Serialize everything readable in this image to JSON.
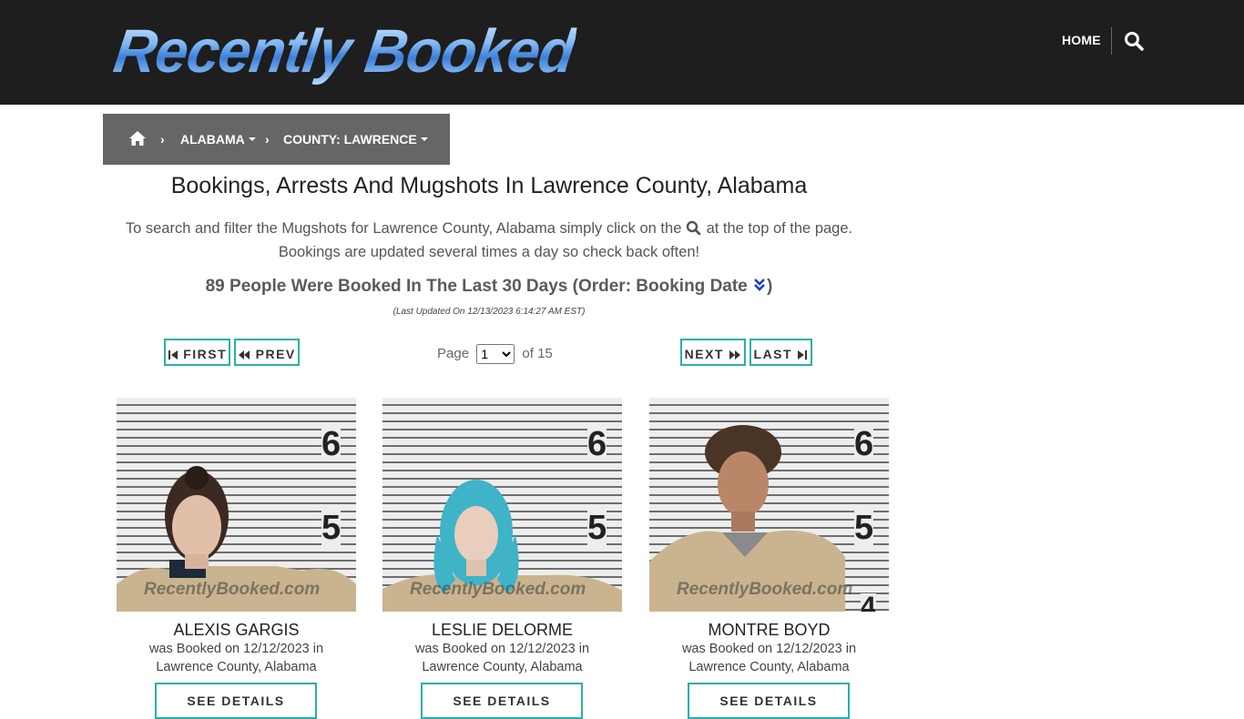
{
  "header": {
    "logo_text": "Recently Booked",
    "nav_home": "HOME"
  },
  "breadcrumb": {
    "state": "ALABAMA",
    "county": "COUNTY: LAWRENCE"
  },
  "page": {
    "title": "Bookings, Arrests And Mugshots In Lawrence County, Alabama",
    "intro_part1": "To search and filter the Mugshots for Lawrence County, Alabama simply click on the",
    "intro_part2": "at the top of the page.",
    "intro_line2": "Bookings are updated several times a day so check back often!",
    "count_text": "89 People Were Booked In The Last 30 Days (Order: Booking Date",
    "count_close": ")",
    "updated": "(Last Updated On 12/13/2023 6:14:27 AM EST)"
  },
  "pagination": {
    "first": "FIRST",
    "prev": "PREV",
    "next": "NEXT",
    "last": "LAST",
    "page_label": "Page",
    "current_page": "1",
    "of_label": "of 15"
  },
  "cards": [
    {
      "name": "ALEXIS GARGIS",
      "line1": "was Booked on 12/12/2023 in",
      "line2": "Lawrence County, Alabama",
      "watermark": "RecentlyBooked.com",
      "button": "SEE DETAILS"
    },
    {
      "name": "LESLIE DELORME",
      "line1": "was Booked on 12/12/2023 in",
      "line2": "Lawrence County, Alabama",
      "watermark": "RecentlyBooked.com",
      "button": "SEE DETAILS"
    },
    {
      "name": "MONTRE BOYD",
      "line1": "was Booked on 12/12/2023 in",
      "line2": "Lawrence County, Alabama",
      "watermark": "RecentlyBooked.com",
      "button": "SEE DETAILS"
    }
  ],
  "colors": {
    "header_bg": "#1e1e1e",
    "breadcrumb_bg": "#666666",
    "button_border": "#2ab0a8",
    "order_icon": "#1a3fc9"
  },
  "icons": [
    "home-icon",
    "search-icon",
    "chevron-right-icon",
    "caret-down-icon",
    "double-chevron-down-icon",
    "step-backward-icon",
    "backward-icon",
    "forward-icon",
    "step-forward-icon"
  ]
}
